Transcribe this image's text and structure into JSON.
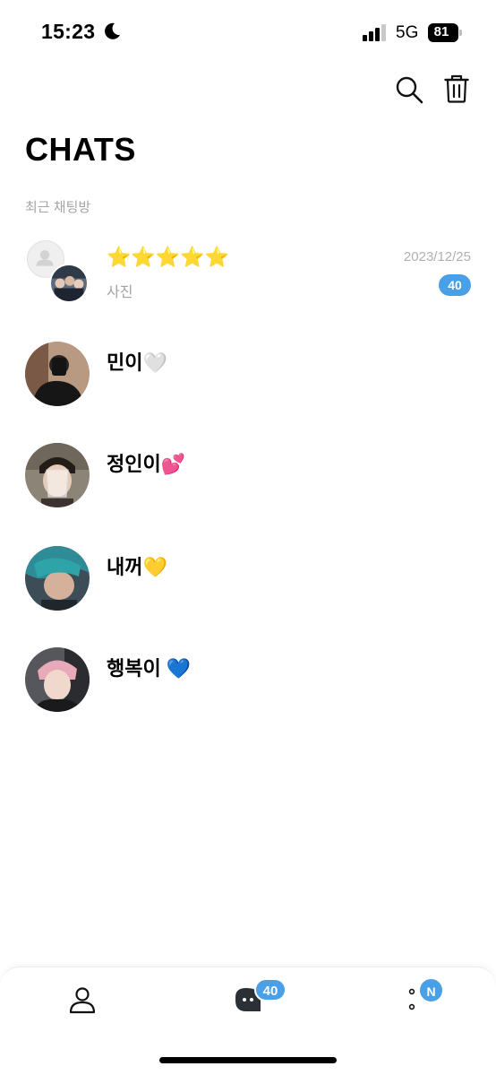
{
  "status_bar": {
    "time": "15:23",
    "network": "5G",
    "battery": "81"
  },
  "header": {
    "title": "CHATS",
    "section_label": "최근 채팅방"
  },
  "chats": [
    {
      "name": "⭐⭐⭐⭐⭐",
      "preview": "사진",
      "date": "2023/12/25",
      "unread": "40"
    },
    {
      "name": "민이🤍"
    },
    {
      "name": "정인이💕"
    },
    {
      "name": "내꺼💛"
    },
    {
      "name": "행복이 💙"
    }
  ],
  "tab_bar": {
    "chat_badge": "40",
    "more_badge": "N"
  },
  "icons": {
    "status": [
      "moon-icon",
      "signal-icon",
      "battery-icon"
    ],
    "header": [
      "search-icon",
      "trash-icon"
    ],
    "tabs": [
      "person-icon",
      "chat-bubble-icon",
      "more-icon"
    ]
  },
  "colors": {
    "accent": "#4aa0e6",
    "muted_text": "#a5a5a5"
  }
}
